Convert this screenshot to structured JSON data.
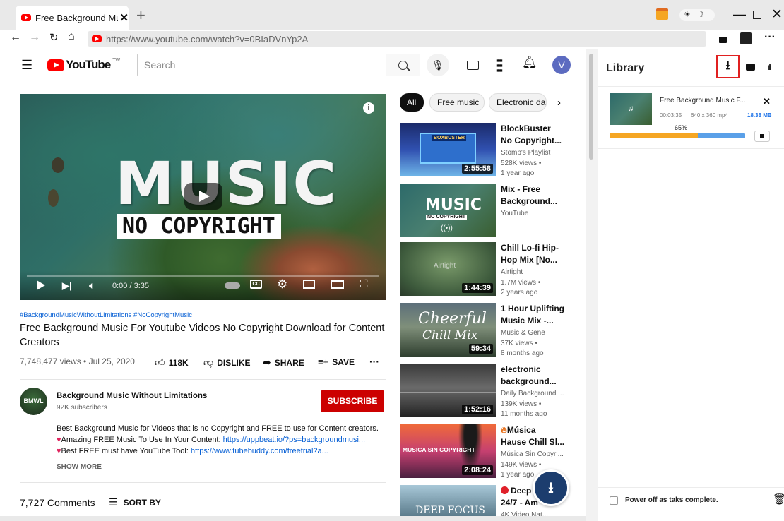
{
  "browser": {
    "tab_title": "Free Background Mus",
    "url": "https://www.youtube.com/watch?v=0BIaDVnYp2A"
  },
  "youtube": {
    "logo": "YouTube",
    "logo_sup": "TW",
    "search_placeholder": "Search",
    "avatar_letter": "V",
    "video": {
      "hashtags": "#BackgroundMusicWithoutLimitations #NoCopyrightMusic",
      "title": "Free Background Music For Youtube Videos No Copyright Download for Content Creators",
      "views_date": "7,748,477 views • Jul 25, 2020",
      "likes": "118K",
      "dislike": "DISLIKE",
      "share": "SHARE",
      "save": "SAVE",
      "time": "0:00 / 3:35",
      "overlay_title": "MUSIC",
      "overlay_sub": "NO COPYRIGHT",
      "progress": 0
    },
    "channel": {
      "name": "Background Music Without Limitations",
      "subs": "92K subscribers",
      "avatar_text": "BMWL",
      "subscribe": "SUBSCRIBE"
    },
    "description": {
      "line1": "Best Background Music for Videos that is no Copyright and FREE to use for Content creators.",
      "line2_text": "Amazing FREE Music To Use In Your Content: ",
      "line2_link": "https://uppbeat.io/?ps=backgroundmusi...",
      "line3_text": "Best FREE must have YouTube Tool: ",
      "line3_link": "https://www.tubebuddy.com/freetrial?a...",
      "show_more": "SHOW MORE"
    },
    "comments": {
      "count": "7,727 Comments",
      "sort": "SORT BY"
    },
    "chips": [
      "All",
      "Free music",
      "Electronic da"
    ],
    "recommended": [
      {
        "title1": "BlockBuster",
        "title2": "No Copyright...",
        "meta": [
          "Stomp's Playlist",
          "528K views •",
          "1 year ago"
        ],
        "duration": "2:55:58",
        "thumb_text": "BOXBUSTER"
      },
      {
        "title1": "Mix - Free",
        "title2": "Background...",
        "meta": [
          "YouTube"
        ],
        "duration": "",
        "thumb_text": "MUSIC",
        "thumb_sub": "NO COPYRIGHT"
      },
      {
        "title1": "Chill Lo-fi Hip-",
        "title2": "Hop Mix [No...",
        "meta": [
          "Airtight",
          "1.7M views •",
          "2 years ago"
        ],
        "duration": "1:44:39",
        "thumb_text": "Airtight"
      },
      {
        "title1": "1 Hour Uplifting",
        "title2": "Music Mix -...",
        "meta": [
          "Music & Gene",
          "37K views •",
          "8 months ago"
        ],
        "duration": "59:34",
        "thumb_text": "Cheerful",
        "thumb_sub": "Chill Mix"
      },
      {
        "title1": "electronic",
        "title2": "background...",
        "meta": [
          "Daily Background ...",
          "139K views •",
          "11 months ago"
        ],
        "duration": "1:52:16",
        "thumb_text": ""
      },
      {
        "title1": "Música",
        "title2": "Hause Chill Sl...",
        "meta": [
          "Música Sin Copyri...",
          "149K views •",
          "1 year ago"
        ],
        "duration": "2:08:24",
        "thumb_text": "MUSICA SIN COPYRIGHT"
      },
      {
        "title1": "Deep",
        "title2": "24/7 - Am",
        "meta": [
          "4K Video Nat..."
        ],
        "duration": "",
        "thumb_text": "DEEP FOCUS"
      }
    ]
  },
  "library": {
    "title": "Library",
    "item": {
      "title": "Free Background Music F...",
      "duration": "00:03:35",
      "resolution": "640 x 360 mp4",
      "size": "18.38 MB",
      "percent_label": "65%",
      "percent": 0.65
    },
    "power_off": "Power off as taks complete."
  },
  "colors": {
    "youtube_red": "#ff0000",
    "subscribe": "#cc0000",
    "link": "#065fd4",
    "library_blue": "#1e73e8",
    "progress_orange": "#f5a623",
    "progress_blue": "#5aa0e8",
    "highlight_border": "#e02020"
  }
}
